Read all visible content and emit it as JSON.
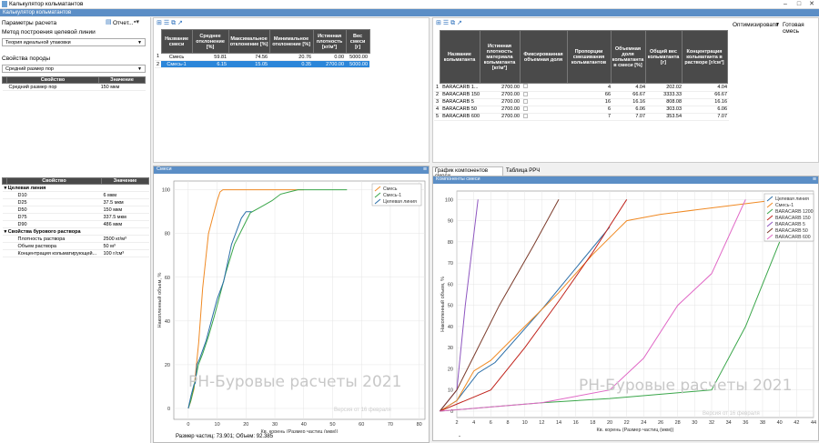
{
  "window": {
    "title": "Калькулятор кольматантов",
    "subtitle": "Калькулятор кольматантов",
    "min": "–",
    "max": "□",
    "close": "✕"
  },
  "left": {
    "params_label": "Параметры расчета",
    "report_label": "Отчет...",
    "method_label": "Метод построения целевой линии",
    "method_value": "Теория идеальной упаковки",
    "rock_label": "Свойства породы",
    "rock_select": "Средний размер пор",
    "rock_headers": [
      "Свойство",
      "Значение"
    ],
    "rock_rows": [
      [
        "Средний размер пор",
        "150 мкм"
      ]
    ],
    "props_headers": [
      "Свойство",
      "Значение"
    ],
    "groups": [
      {
        "title": "Целевая линия",
        "rows": [
          [
            "D10",
            "6 мкм"
          ],
          [
            "D25",
            "37.5 мкм"
          ],
          [
            "D50",
            "150 мкм"
          ],
          [
            "D75",
            "337.5 мкм"
          ],
          [
            "D90",
            "486 мкм"
          ]
        ]
      },
      {
        "title": "Свойства бурового раствора",
        "rows": [
          [
            "Плотность раствора",
            "2500 кг/м³"
          ],
          [
            "Объем раствора",
            "50 м³"
          ],
          [
            "Концентрация кольматирующей...",
            "100 г/см³"
          ]
        ]
      }
    ]
  },
  "mix_table": {
    "headers": [
      "Название смеси",
      "Среднее отклонение [%]",
      "Максимальное отклонение [%]",
      "Минимальное отклонение [%]",
      "Истинная плотность [кг/м³]",
      "Вес смеси [г]"
    ],
    "rows": [
      [
        "1",
        "Смесь",
        "59.81",
        "74.56",
        "20.76",
        "0.00",
        "5000.00"
      ],
      [
        "2",
        "Смесь-1",
        "6.15",
        "15.05",
        "0.35",
        "2700.00",
        "5000.00"
      ]
    ]
  },
  "comp_table": {
    "optimize": "Оптимизировать",
    "ready": "Готовая смесь",
    "headers": [
      "Название кольматанта",
      "Истинная плотность материала кольматанта [кг/м³]",
      "Фиксированная объемная доля",
      "Пропорции смешивания кольматантов",
      "Объемная доля кольматанта в смеси [%]",
      "Общий вес кольматанта [г]",
      "Концентрация кольматанта в растворе [г/см³]"
    ],
    "rows": [
      [
        "1",
        "BARACARB 1...",
        "2700.00",
        "",
        "4",
        "4.04",
        "202.02",
        "4.04"
      ],
      [
        "2",
        "BARACARB 150",
        "2700.00",
        "",
        "66",
        "66.67",
        "3333.33",
        "66.67"
      ],
      [
        "3",
        "BARACARB 5",
        "2700.00",
        "",
        "16",
        "16.16",
        "808.08",
        "16.16"
      ],
      [
        "4",
        "BARACARB 50",
        "2700.00",
        "",
        "6",
        "6.06",
        "303.03",
        "6.06"
      ],
      [
        "5",
        "BARACARB 600",
        "2700.00",
        "",
        "7",
        "7.07",
        "353.54",
        "7.07"
      ]
    ]
  },
  "left_chart": {
    "title": "Смеси",
    "footer": "Размер частиц: 73.901; Объем: 92.385",
    "watermark": "РН-Буровые расчеты 2021",
    "version": "Версия от 16 февраля"
  },
  "right_tabs": [
    "График компонентов смеси",
    "Таблица РРЧ"
  ],
  "right_chart": {
    "title": "Компоненты смеси",
    "watermark": "РН-Буровые расчеты 2021",
    "version": "Версия от 16 февраля",
    "dash": "-"
  },
  "chart_data": [
    {
      "type": "line",
      "title": "",
      "xlabel": "Кв. корень (Размер частиц (мкм))",
      "ylabel": "Накопленный объем, %",
      "xlim": [
        -5,
        82
      ],
      "ylim": [
        -5,
        104
      ],
      "xticks": [
        0,
        10,
        20,
        30,
        40,
        50,
        60,
        70,
        80
      ],
      "yticks": [
        0,
        20,
        40,
        60,
        80,
        100
      ],
      "legend": "top-right",
      "series": [
        {
          "name": "Смесь",
          "color": "#f08a24",
          "x": [
            0,
            0.8,
            2,
            3.6,
            5,
            7,
            9,
            10,
            10.5,
            11,
            12,
            13,
            14,
            16,
            18,
            20,
            25,
            30,
            40
          ],
          "y": [
            0,
            3,
            9,
            30,
            55,
            80,
            90,
            95,
            97,
            99,
            100,
            100,
            100,
            100,
            100,
            100,
            100,
            100,
            100
          ]
        },
        {
          "name": "Смесь-1",
          "color": "#3aa64a",
          "x": [
            0,
            1,
            2,
            3.5,
            5,
            7,
            9,
            11,
            13,
            16,
            21.5,
            25,
            29,
            32,
            35,
            38,
            40,
            42,
            45,
            48,
            55
          ],
          "y": [
            0,
            4,
            10,
            20,
            25,
            33,
            42,
            52,
            62,
            75,
            89.5,
            92,
            95,
            98,
            99,
            100,
            100,
            100,
            100,
            100,
            100
          ]
        },
        {
          "name": "Целевая линия",
          "color": "#2b6ea8",
          "x": [
            0,
            0.5,
            1,
            2,
            2.45,
            3,
            4,
            6.2,
            8,
            10,
            12.25,
            15,
            18.4,
            20,
            22
          ],
          "y": [
            0,
            3,
            6,
            11,
            11.5,
            20,
            23,
            31,
            40,
            50,
            58,
            75,
            87,
            90,
            90
          ]
        }
      ]
    },
    {
      "type": "line",
      "title": "",
      "xlabel": "Кв. корень (Размер частиц (мкм))",
      "ylabel": "Накопленный объем, %",
      "xlim": [
        2,
        44
      ],
      "ylim": [
        -3,
        104
      ],
      "xticks": [
        2,
        4,
        6,
        8,
        10,
        12,
        14,
        16,
        18,
        20,
        22,
        24,
        26,
        28,
        30,
        32,
        34,
        36,
        38,
        40,
        42,
        44
      ],
      "yticks": [
        0,
        10,
        20,
        30,
        40,
        50,
        60,
        70,
        80,
        90,
        100
      ],
      "legend": "top-right",
      "series": [
        {
          "name": "Целевая линия",
          "color": "#2b6ea8",
          "x": [
            0,
            2,
            4.5,
            6.5,
            12,
            20
          ],
          "y": [
            0,
            5,
            18,
            23,
            48,
            87
          ]
        },
        {
          "name": "Смесь-1",
          "color": "#f08a24",
          "x": [
            0,
            2,
            4,
            6,
            10,
            14,
            18,
            22,
            26,
            30,
            34,
            40
          ],
          "y": [
            0,
            5,
            19,
            24,
            40,
            56,
            74,
            90,
            93,
            95,
            97,
            100
          ]
        },
        {
          "name": "BARACARB 1200",
          "color": "#3aa64a",
          "x": [
            0,
            6,
            12,
            20,
            26,
            32,
            36,
            40
          ],
          "y": [
            0,
            2,
            4,
            6,
            8,
            10,
            40,
            80
          ]
        },
        {
          "name": "BARACARB 150",
          "color": "#c0231c",
          "x": [
            0,
            3,
            6,
            10,
            14,
            18,
            22
          ],
          "y": [
            0,
            5,
            10,
            30,
            52,
            75,
            100
          ]
        },
        {
          "name": "BARACARB 5",
          "color": "#8e56c0",
          "x": [
            0,
            1,
            2,
            3,
            4.5
          ],
          "y": [
            0,
            5,
            10,
            50,
            100
          ]
        },
        {
          "name": "BARACARB 50",
          "color": "#7a3a2a",
          "x": [
            0,
            2,
            4,
            7,
            11,
            14
          ],
          "y": [
            0,
            10,
            26,
            50,
            78,
            100
          ]
        },
        {
          "name": "BARACARB 600",
          "color": "#e068c6",
          "x": [
            0,
            6,
            12,
            20,
            24,
            28,
            32,
            36
          ],
          "y": [
            0,
            2,
            4,
            10,
            25,
            50,
            65,
            100
          ]
        }
      ]
    }
  ]
}
